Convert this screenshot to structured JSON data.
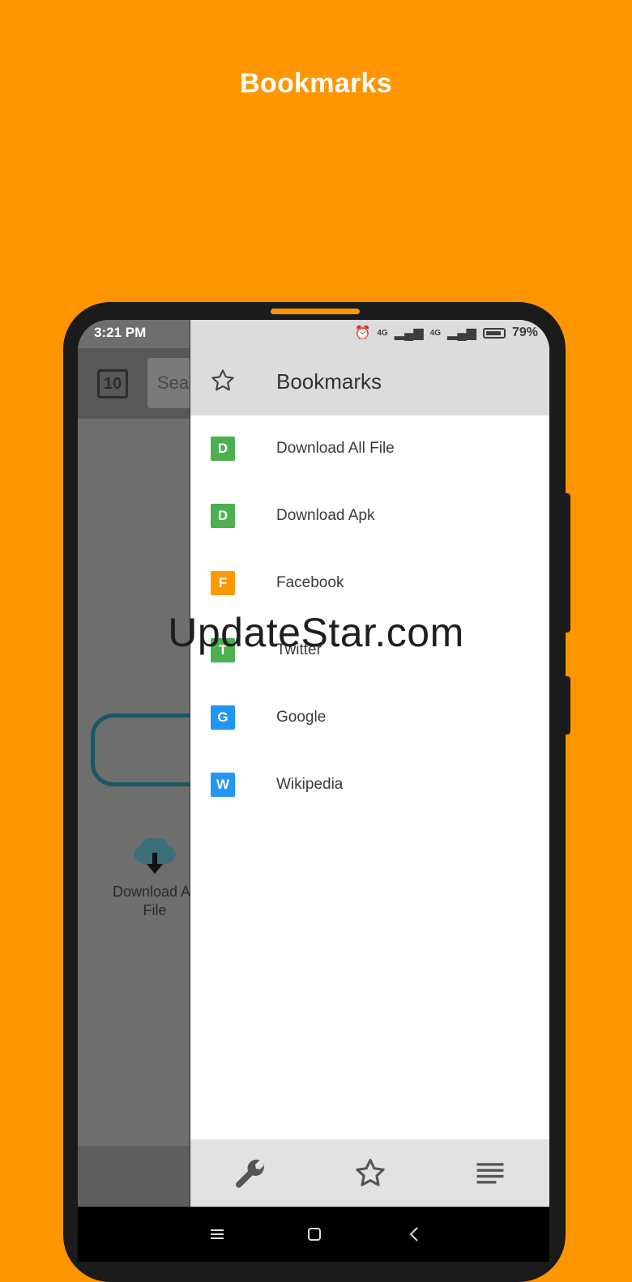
{
  "promo": {
    "title": "Bookmarks"
  },
  "status": {
    "time": "3:21 PM",
    "net1": "4G",
    "net2": "4G",
    "battery": "79%"
  },
  "background_app": {
    "tab_count": "10",
    "search_placeholder": "Sea",
    "shortcut_label": "Download All File"
  },
  "drawer": {
    "title": "Bookmarks",
    "items": [
      {
        "letter": "D",
        "label": "Download All File",
        "color": "#4CAF50"
      },
      {
        "letter": "D",
        "label": "Download Apk",
        "color": "#4CAF50"
      },
      {
        "letter": "F",
        "label": "Facebook",
        "color": "#FF9800"
      },
      {
        "letter": "T",
        "label": "Twitter",
        "color": "#4CAF50"
      },
      {
        "letter": "G",
        "label": "Google",
        "color": "#2196F3"
      },
      {
        "letter": "W",
        "label": "Wikipedia",
        "color": "#2196F3"
      }
    ]
  },
  "watermark": "UpdateStar.com",
  "colors": {
    "background": "#FF9500",
    "phone": "#1b1b1b",
    "drawer_header": "#dcdcdc"
  }
}
